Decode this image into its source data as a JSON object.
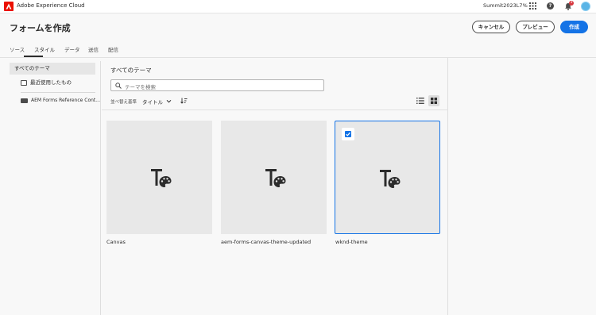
{
  "shell": {
    "title": "Adobe Experience Cloud",
    "org": "Summit2023L7%",
    "notification_count": "3"
  },
  "header": {
    "title": "フォームを作成",
    "cancel_label": "キャンセル",
    "preview_label": "プレビュー",
    "create_label": "作成"
  },
  "tabs": [
    {
      "label": "ソース"
    },
    {
      "label": "スタイル"
    },
    {
      "label": "データ"
    },
    {
      "label": "送信"
    },
    {
      "label": "配信"
    }
  ],
  "sidebar": {
    "items": [
      {
        "label": "すべてのテーマ"
      },
      {
        "label": "最近使用したもの"
      },
      {
        "label": "AEM Forms Reference Cont..."
      }
    ]
  },
  "main": {
    "heading": "すべてのテーマ",
    "search_placeholder": "テーマを検索",
    "sort_label": "並べ替え基準",
    "sort_value": "タイトル",
    "cards": [
      {
        "label": "Canvas",
        "selected": false
      },
      {
        "label": "aem-forms-canvas-theme-updated",
        "selected": false
      },
      {
        "label": "wknd-theme",
        "selected": true
      }
    ]
  },
  "colors": {
    "accent": "#1473e6",
    "brand": "#eb1000",
    "card_bg": "#e8e8e8"
  },
  "icons": [
    "adobe-logo",
    "apps-grid-icon",
    "help-icon",
    "bell-icon",
    "avatar",
    "image-icon",
    "folder-icon",
    "search-icon",
    "chevron-down-icon",
    "sort-direction-icon",
    "list-view-icon",
    "grid-view-icon",
    "theme-icon",
    "checkbox-icon"
  ]
}
